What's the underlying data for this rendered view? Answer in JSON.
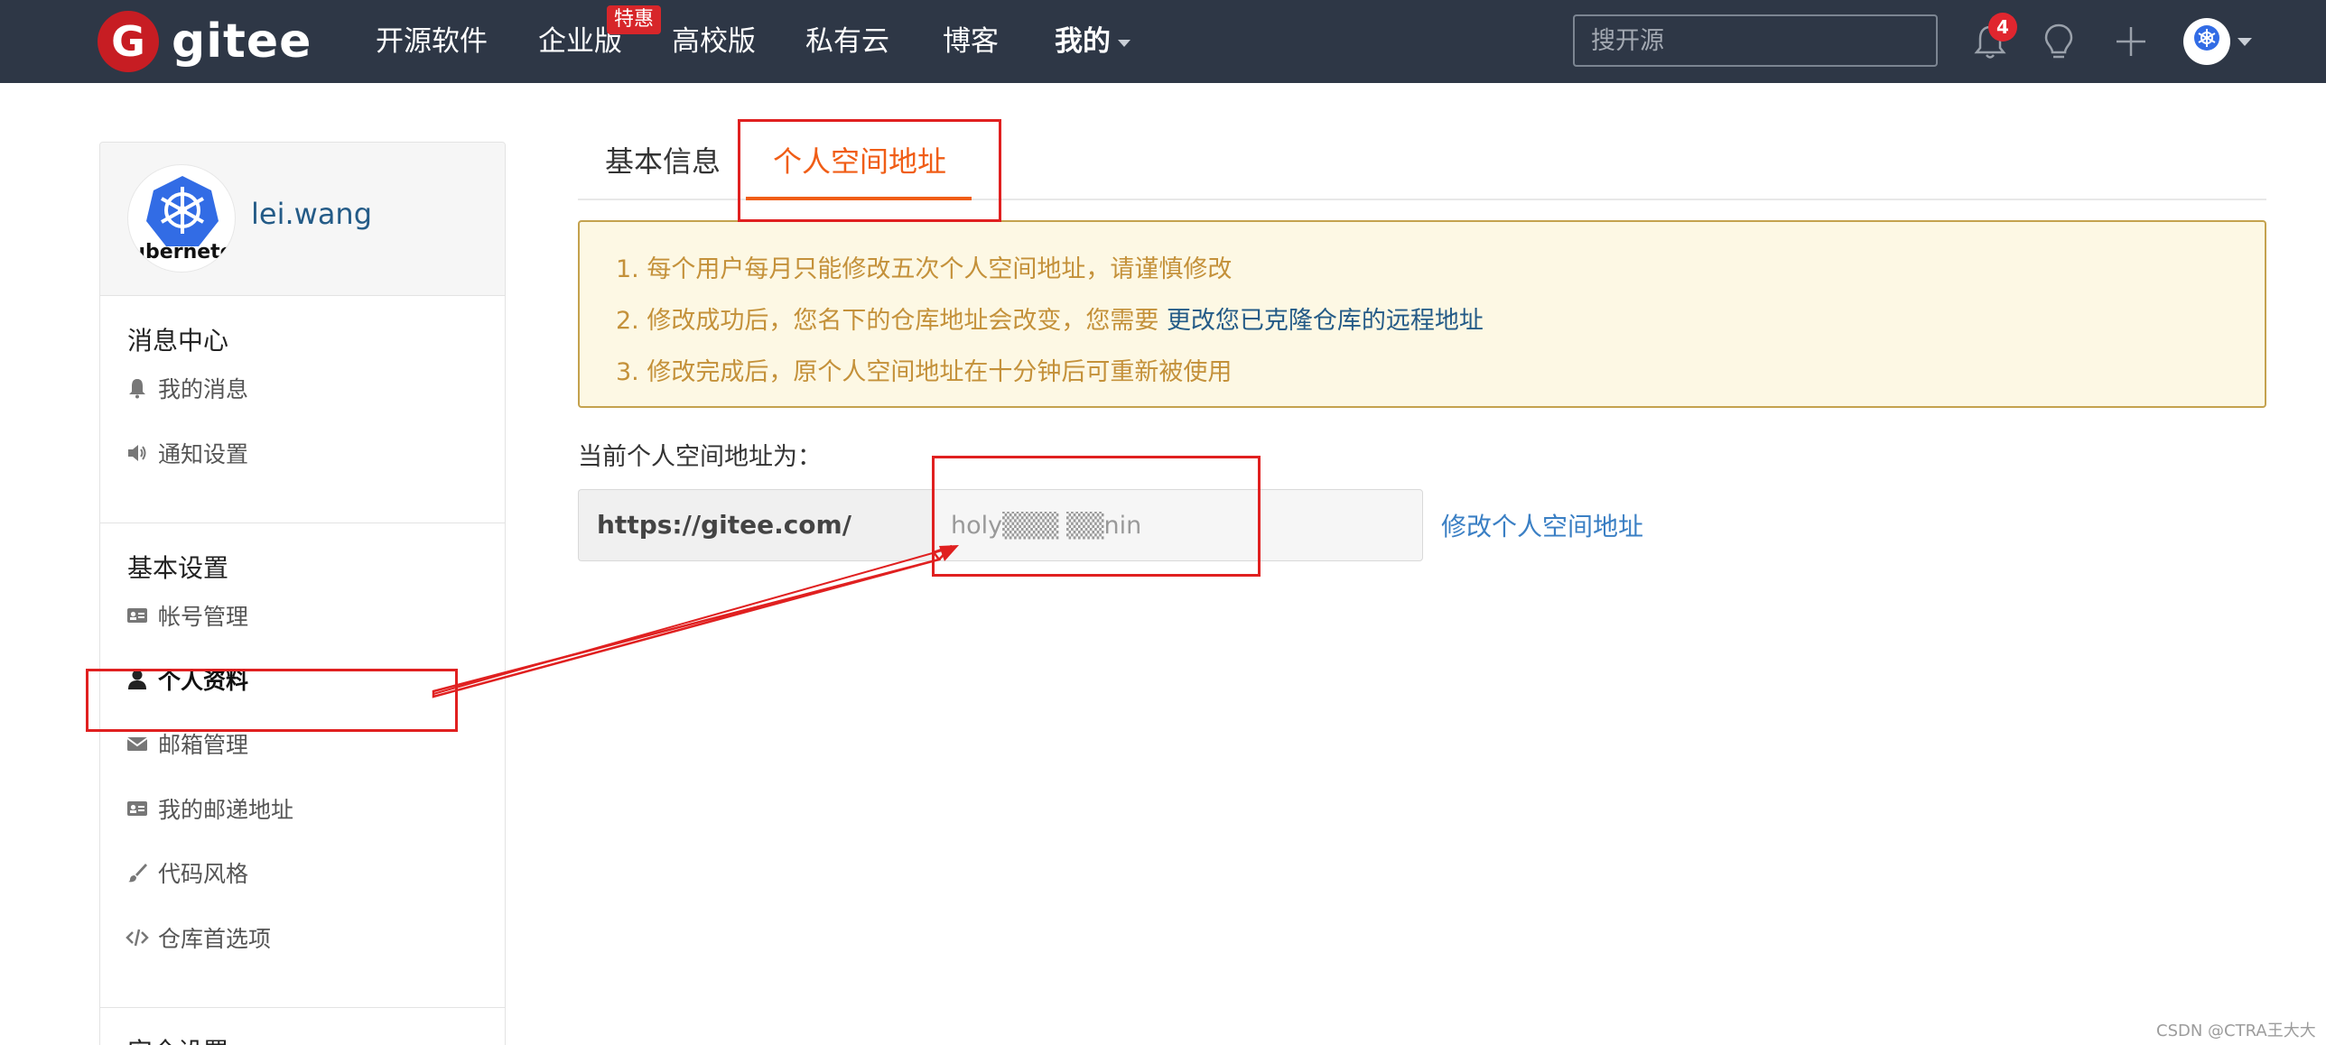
{
  "brand": {
    "name": "gitee",
    "logo_letter": "G"
  },
  "nav": {
    "items": [
      {
        "label": "开源软件"
      },
      {
        "label": "企业版"
      },
      {
        "label": "高校版"
      },
      {
        "label": "私有云"
      },
      {
        "label": "博客"
      },
      {
        "label": "我的"
      }
    ],
    "promo_badge": "特惠",
    "search_placeholder": "搜开源",
    "notification_count": "4"
  },
  "sidebar": {
    "username": "lei.wang",
    "avatar_caption": "ubernete",
    "groups": [
      {
        "title": "消息中心",
        "items": [
          {
            "label": "我的消息",
            "icon": "bell-icon"
          },
          {
            "label": "通知设置",
            "icon": "speaker-icon"
          }
        ]
      },
      {
        "title": "基本设置",
        "items": [
          {
            "label": "帐号管理",
            "icon": "id-card-icon"
          },
          {
            "label": "个人资料",
            "icon": "user-icon"
          },
          {
            "label": "邮箱管理",
            "icon": "envelope-icon"
          },
          {
            "label": "我的邮递地址",
            "icon": "id-card-icon"
          },
          {
            "label": "代码风格",
            "icon": "brush-icon"
          },
          {
            "label": "仓库首选项",
            "icon": "code-icon"
          }
        ]
      },
      {
        "title": "安全设置"
      }
    ],
    "active_item": "个人资料"
  },
  "main": {
    "tabs": [
      {
        "label": "基本信息"
      },
      {
        "label": "个人空间地址"
      }
    ],
    "active_tab": "个人空间地址",
    "notice": {
      "line1": "1. 每个用户每月只能修改五次个人空间地址，请谨慎修改",
      "line2_prefix": "2. 修改成功后，您名下的仓库地址会改变，您需要",
      "line2_link": "更改您已克隆仓库的远程地址",
      "line3": "3. 修改完成后，原个人空间地址在十分钟后可重新被使用"
    },
    "current_label": "当前个人空间地址为：",
    "url_prefix": "https://gitee.com/",
    "url_value": "holy▒▒▒ ▒▒nin",
    "edit_link": "修改个人空间地址"
  },
  "colors": {
    "topbar": "#2e3746",
    "brand_red": "#c71d23",
    "accent_orange": "#f05d16",
    "link_blue": "#3a7fc4",
    "notice_bg": "#fdf8e4",
    "notice_text": "#c4913a",
    "annotation_red": "#e02020"
  },
  "watermark": "CSDN @CTRA王大大"
}
